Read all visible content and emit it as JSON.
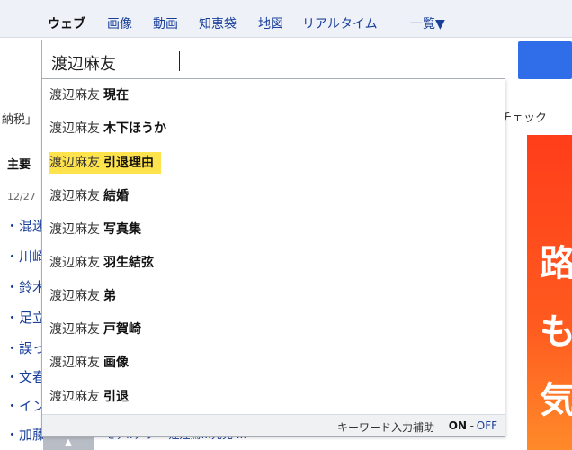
{
  "search_tabs": [
    "ウェブ",
    "画像",
    "動画",
    "知恵袋",
    "地図",
    "リアルタイム",
    "一覧▼"
  ],
  "search": {
    "query": "渡辺麻友"
  },
  "suggestions": [
    {
      "query": "渡辺麻友",
      "suffix": "現在"
    },
    {
      "query": "渡辺麻友",
      "suffix": "木下ほうか"
    },
    {
      "query": "渡辺麻友",
      "suffix": "引退理由"
    },
    {
      "query": "渡辺麻友",
      "suffix": "結婚"
    },
    {
      "query": "渡辺麻友",
      "suffix": "写真集"
    },
    {
      "query": "渡辺麻友",
      "suffix": "羽生結弦"
    },
    {
      "query": "渡辺麻友",
      "suffix": "弟"
    },
    {
      "query": "渡辺麻友",
      "suffix": "戸賀崎"
    },
    {
      "query": "渡辺麻友",
      "suffix": "画像"
    },
    {
      "query": "渡辺麻友",
      "suffix": "引退"
    }
  ],
  "suggest_footer": {
    "label": "キーワード入力補助",
    "on": "ON",
    "sep": "-",
    "off": "OFF"
  },
  "background": {
    "left_snippet": "納税」",
    "right_snippet": "チェック",
    "heading": "主要",
    "date": "12/27",
    "news_items": [
      "・混迷",
      "・川崎",
      "・鈴木",
      "・足立",
      "・誤っ",
      "・文春",
      "・イン",
      "・加藤"
    ],
    "footer_link": "・モデ..テリー 娃娃鶯...元充 ..."
  },
  "ad": {
    "chars": [
      "路",
      "も",
      "気"
    ]
  },
  "colors": {
    "highlight": "#ffe34d",
    "accent": "#2f6ee8",
    "link": "#1a3f9a"
  }
}
